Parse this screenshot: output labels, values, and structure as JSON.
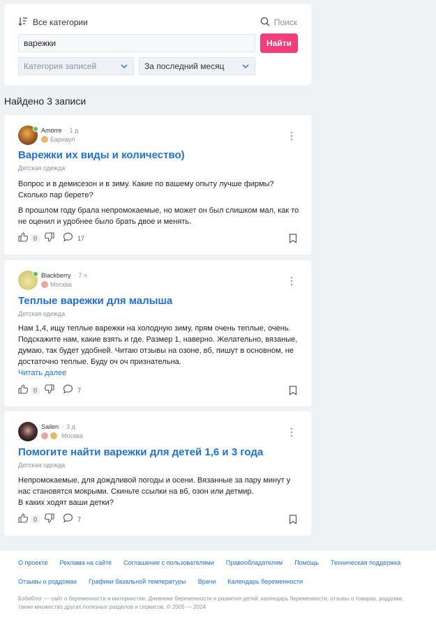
{
  "filter": {
    "all_categories": "Все категории",
    "search_link": "Поиск",
    "query": "варежки",
    "submit": "Найти",
    "category_placeholder": "Категория записей",
    "period": "За последний месяц"
  },
  "results": {
    "found": "Найдено 3 записи"
  },
  "posts": [
    {
      "author": "Amorre",
      "time": "1 д",
      "city": "Барнаул",
      "title": "Варежки их виды и количество)",
      "category": "Детская одежда",
      "paragraphs": [
        "Вопрос и в демисезон и в зиму. Какие по вашему опыту лучше фирмы? Сколько пар берете?",
        "В прошлом году брала непромокаемые, но может он был слишком мал, как то не оценил и удобнее было брать двое и менять."
      ],
      "likes": "0",
      "comments": "17"
    },
    {
      "author": "Blackberry",
      "time": "7 ч",
      "city": "Москва",
      "title": "Теплые варежки для малыша",
      "category": "Детская одежда",
      "text": "Нам 1,4, ищу теплые варежки на холодную зиму, прям очень теплые, очень. Подскажите нам, какие взять и где. Размер 1, наверно. Желательно, вязаные, думаю, так будет удобней. Читаю отзывы на озоне, вб, пишут в основном, не достаточно теплые. Буду оч оч признательна.",
      "read_more": "Читать далее",
      "likes": "0",
      "comments": "7"
    },
    {
      "author": "Sailen",
      "time": "3 д",
      "city": "Москва",
      "title": "Помогите найти варежки для детей 1,6 и 3 года",
      "category": "Детская одежда",
      "text": "Непромокаемые, для дождливой погоды и осени. Вязанные за пару минут у нас становятся мокрыми. Скиньте ссылки на вб, озон или детмир.\nВ каких ходят ваши детки?",
      "likes": "0",
      "comments": "7"
    }
  ],
  "footer": {
    "row1": [
      "О проекте",
      "Реклама на сайте",
      "Соглашение с пользователями",
      "Правообладателям",
      "Помощь",
      "Техническая поддержка"
    ],
    "row2": [
      "Отзывы о роддомах",
      "Графики базальной температуры",
      "Врачи",
      "Календарь беременности"
    ],
    "copyright_line1": "Бэбиблог — сайт о беременности и материнстве. Дневники беременности и развития детей, календарь беременности, отзывы о товарах, роддома,",
    "copyright_line2": "также множество других полезных разделов и сервисов. © 2005 — 2024"
  },
  "icons": [
    "sort-icon",
    "search-icon",
    "chevron-down-icon",
    "more-vertical-icon",
    "thumbs-up-icon",
    "thumbs-down-icon",
    "comment-icon",
    "bookmark-icon",
    "child-icon"
  ],
  "colors": {
    "accent": "#f23d79",
    "link": "#1f6fd6",
    "background": "#eef2f5",
    "online": "#5bc34b"
  }
}
